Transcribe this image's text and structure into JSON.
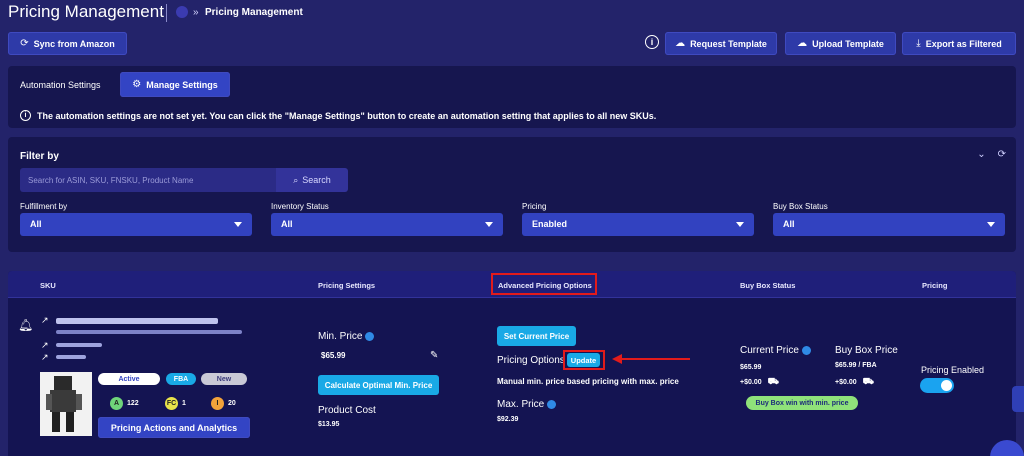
{
  "header": {
    "title": "Pricing Management",
    "breadcrumb_arrow": "»",
    "breadcrumb": "Pricing Management"
  },
  "toolbar": {
    "sync_label": "Sync from Amazon",
    "info_label": "i",
    "request_template_label": "Request Template",
    "upload_template_label": "Upload Template",
    "export_label": "Export as Filtered"
  },
  "automation": {
    "label": "Automation Settings",
    "manage_label": "Manage Settings",
    "info_text": "The automation settings are not set yet. You can click the \"Manage Settings\" button to create an automation setting that applies to all new SKUs."
  },
  "filter": {
    "title": "Filter by",
    "search_placeholder": "Search for ASIN, SKU, FNSKU, Product Name",
    "search_button": "Search",
    "fields": [
      {
        "label": "Fulfillment by",
        "value": "All"
      },
      {
        "label": "Inventory Status",
        "value": "All"
      },
      {
        "label": "Pricing",
        "value": "Enabled"
      },
      {
        "label": "Buy Box Status",
        "value": "All"
      }
    ]
  },
  "table": {
    "columns": [
      "SKU",
      "Pricing Settings",
      "Advanced Pricing Options",
      "Buy Box Status",
      "Pricing"
    ],
    "row": {
      "status_pills": [
        "Active",
        "FBA",
        "New"
      ],
      "counts": [
        {
          "badge": "A",
          "value": "122",
          "color": "#6fd47a"
        },
        {
          "badge": "FC",
          "value": "1",
          "color": "#e8e34a"
        },
        {
          "badge": "I",
          "value": "20",
          "color": "#f2a23a"
        }
      ],
      "actions_label": "Pricing Actions and Analytics",
      "min_price_label": "Min. Price",
      "min_price_value": "$65.99",
      "calc_button": "Calculate Optimal Min. Price",
      "product_cost_label": "Product Cost",
      "product_cost_value": "$13.95",
      "set_current_price": "Set Current Price",
      "pricing_options_label": "Pricing Options",
      "update_button": "Update",
      "pricing_options_desc": "Manual min. price based pricing with max. price",
      "max_price_label": "Max. Price",
      "max_price_value": "$92.39",
      "current_price_label": "Current Price",
      "current_price_value": "$65.99",
      "current_price_shipping": "+$0.00",
      "buybox_price_label": "Buy Box Price",
      "buybox_price_value": "$65.99 / FBA",
      "buybox_price_shipping": "+$0.00",
      "buybox_status": "Buy Box win with min. price",
      "pricing_enabled_label": "Pricing Enabled"
    }
  },
  "colors": {
    "background": "#23236a",
    "panel": "#16164f",
    "accent": "#19a9e6",
    "highlight": "#e21b1b"
  }
}
